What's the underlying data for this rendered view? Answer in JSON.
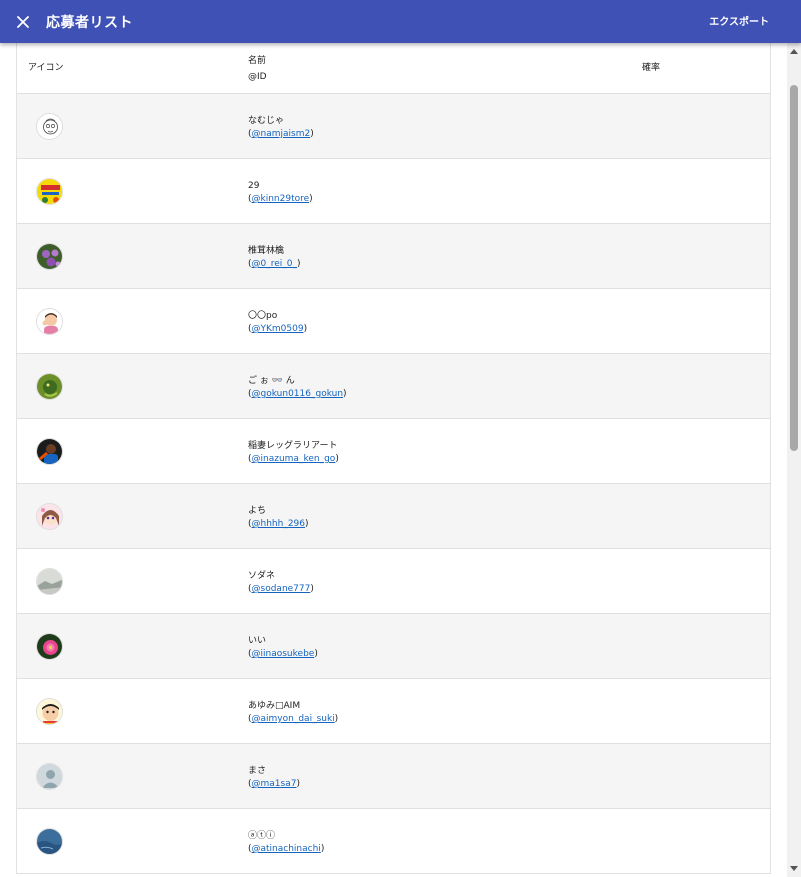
{
  "dialog": {
    "title": "応募者リスト",
    "export_label": "エクスポート",
    "accent_color": "#3f51b5"
  },
  "table": {
    "headers": {
      "icon": "アイコン",
      "name": "名前",
      "id": "@ID",
      "probability": "確率"
    },
    "rows": [
      {
        "name": "なむじゃ",
        "handle": "@namjaism2",
        "avatar": "line-drawing-face"
      },
      {
        "name": "29",
        "handle": "@kinn29tore",
        "avatar": "yellow-poster"
      },
      {
        "name": "椎茸林檎",
        "handle": "@0_rei_0_",
        "avatar": "purple-flowers"
      },
      {
        "name": "〇〇po",
        "handle": "@YKm0509",
        "avatar": "illustration-person"
      },
      {
        "name": "ご ぉ 👓 ん",
        "handle": "@gokun0116_gokun",
        "avatar": "green-character"
      },
      {
        "name": "稲妻レッグラリアート",
        "handle": "@inazuma_ken_go",
        "avatar": "athlete-photo"
      },
      {
        "name": "よち",
        "handle": "@hhhh_296",
        "avatar": "anime-girl"
      },
      {
        "name": "ソダネ",
        "handle": "@sodane777",
        "avatar": "landscape"
      },
      {
        "name": "いい",
        "handle": "@iinaosukebe",
        "avatar": "pink-flower"
      },
      {
        "name": "あゆみ□AIM",
        "handle": "@aimyon_dai_suki",
        "avatar": "cartoon-kid"
      },
      {
        "name": "まさ",
        "handle": "@ma1sa7",
        "avatar": "default-user"
      },
      {
        "name": "ⓐⓣⓘ",
        "handle": "@atinachinachi",
        "avatar": "blue-water"
      }
    ]
  }
}
